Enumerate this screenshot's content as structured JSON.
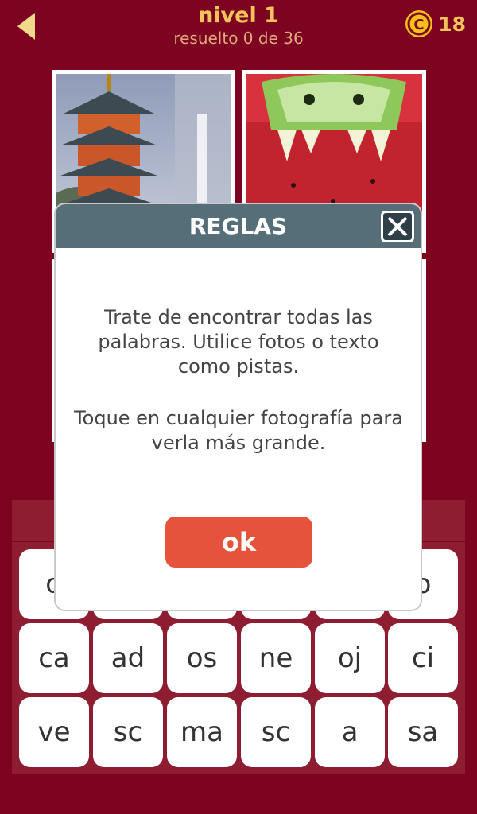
{
  "header": {
    "level_title": "nivel 1",
    "progress_text": "resuelto 0 de 36",
    "coin_count": "18",
    "back_icon": "back-arrow-icon",
    "coin_icon": "coin-icon"
  },
  "colors": {
    "background": "#7d0420",
    "accent_gold": "#f2c35b",
    "modal_header": "#556e78",
    "ok_button": "#e6533c"
  },
  "photos": [
    {
      "name": "photo-pagoda"
    },
    {
      "name": "photo-watermelon-dragon"
    },
    {
      "name": "photo-bottom-left"
    },
    {
      "name": "photo-bottom-right"
    }
  ],
  "keyboard": {
    "rows": [
      [
        "d",
        "",
        "",
        "",
        "",
        "o"
      ],
      [
        "ca",
        "ad",
        "os",
        "ne",
        "oj",
        "ci"
      ],
      [
        "ve",
        "sc",
        "ma",
        "sc",
        "a",
        "sa"
      ]
    ]
  },
  "modal": {
    "title": "REGLAS",
    "text_1": "Trate de encontrar todas las palabras. Utilice fotos o texto como pistas.",
    "text_2": "Toque en cualquier fotografía para verla más grande.",
    "ok_label": "ok",
    "close_icon": "close-icon"
  }
}
